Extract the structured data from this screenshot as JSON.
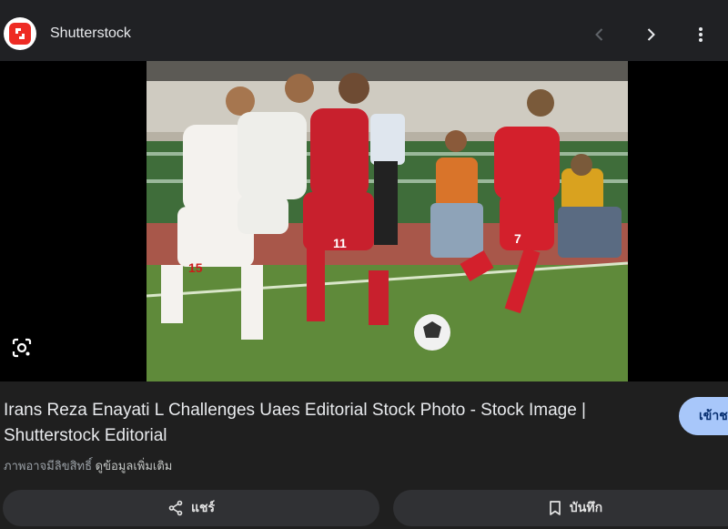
{
  "header": {
    "site_name": "Shutterstock",
    "logo_icon": "shutterstock-logo-icon",
    "nav": {
      "prev_icon": "chevron-left-icon",
      "next_icon": "chevron-right-icon",
      "more_icon": "more-vert-icon"
    }
  },
  "image": {
    "lens_icon": "google-lens-icon"
  },
  "result": {
    "title": "Irans Reza Enayati L Challenges Uaes Editorial Stock Photo - Stock Image | Shutterstock Editorial",
    "visit_label": "เข้าช",
    "copyright_text": "ภาพอาจมีลิขสิทธิ์",
    "more_info_label": "ดูข้อมูลเพิ่มเติม"
  },
  "actions": {
    "share_label": "แชร์",
    "share_icon": "share-icon",
    "save_label": "บันทึก",
    "save_icon": "bookmark-icon"
  },
  "colors": {
    "background": "#1f1f1f",
    "accent": "#a8c7fa",
    "brand": "#ee2b24"
  }
}
